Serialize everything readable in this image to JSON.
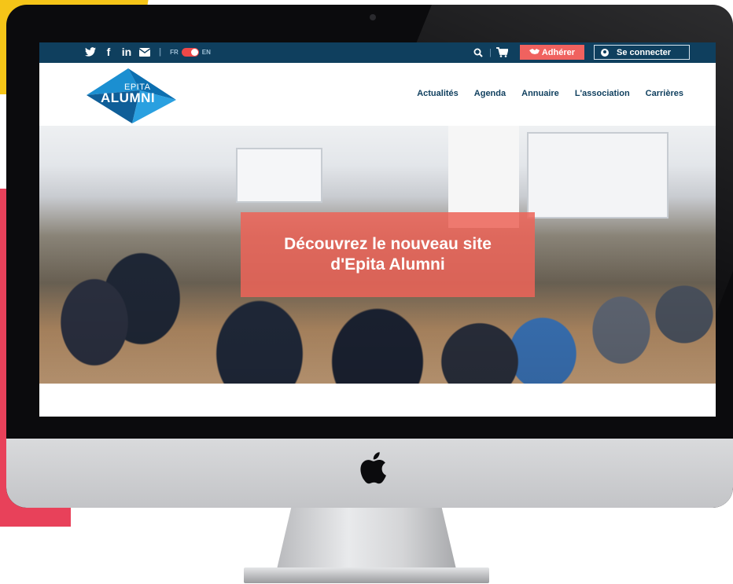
{
  "topbar": {
    "social_icons": [
      "twitter-icon",
      "facebook-icon",
      "linkedin-icon",
      "mail-icon"
    ],
    "social_glyphs": {
      "facebook": "f",
      "linkedin": "in"
    },
    "separator": "|",
    "lang_fr": "FR",
    "lang_en": "EN",
    "join_label": "Adhérer",
    "login_label": "Se connecter"
  },
  "header": {
    "logo_top": "EPITA",
    "logo_main": "ALUMNI",
    "nav": [
      "Actualités",
      "Agenda",
      "Annuaire",
      "L'association",
      "Carrières"
    ]
  },
  "hero": {
    "title": "Découvrez le nouveau site d'Epita Alumni"
  },
  "colors": {
    "topbar": "#0f3f5e",
    "accent": "#f0625f",
    "hero_box": "#ec6458",
    "logo_blue": "#1b8fd1"
  }
}
